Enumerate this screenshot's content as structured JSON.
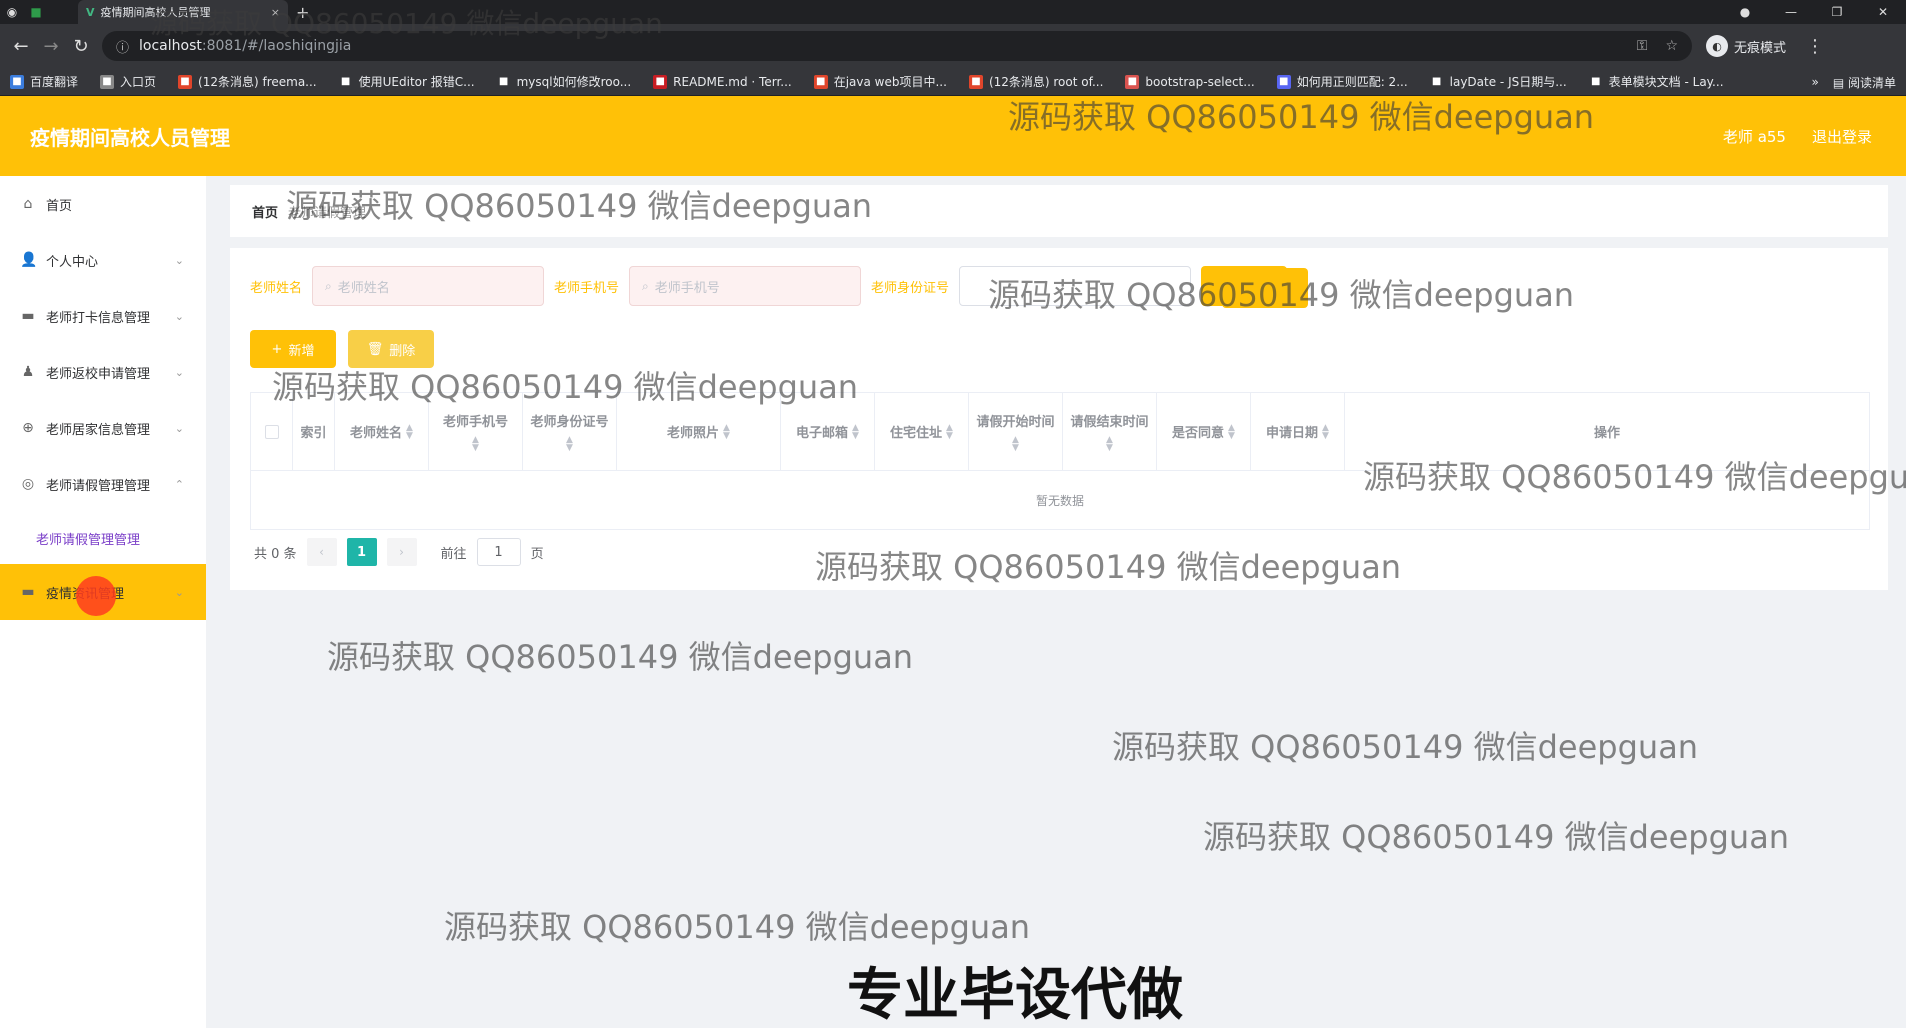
{
  "browser": {
    "tab_title": "疫情期间高校人员管理",
    "tab_close": "×",
    "new_tab": "+",
    "url_host": "localhost",
    "url_path": ":8081/#/laoshiqingjia",
    "incognito_label": "无痕模式",
    "reading_list": "阅读清单",
    "bookmarks": [
      {
        "label": "百度翻译",
        "icon": "translate-icon",
        "color": "#3b7ddd"
      },
      {
        "label": "入口页",
        "icon": "globe-icon",
        "color": "#888888"
      },
      {
        "label": "(12条消息) freema...",
        "icon": "csdn-icon",
        "color": "#e0452b"
      },
      {
        "label": "使用UEditor 报错C...",
        "icon": "doc-icon",
        "color": "#35363a"
      },
      {
        "label": "mysql如何修改roo...",
        "icon": "doc-icon",
        "color": "#35363a"
      },
      {
        "label": "README.md · Terr...",
        "icon": "gitee-icon",
        "color": "#c71d23"
      },
      {
        "label": "在java web项目中...",
        "icon": "csdn-icon",
        "color": "#e0452b"
      },
      {
        "label": "(12条消息) root of...",
        "icon": "csdn-icon",
        "color": "#e0452b"
      },
      {
        "label": "bootstrap-select...",
        "icon": "bookmark-icon",
        "color": "#d9534f"
      },
      {
        "label": "如何用正则匹配: 2...",
        "icon": "bookmark-icon",
        "color": "#5865f2"
      },
      {
        "label": "layDate - JS日期与...",
        "icon": "layui-icon",
        "color": "#35363a"
      },
      {
        "label": "表单模块文档 - Lay...",
        "icon": "layui-icon",
        "color": "#35363a"
      }
    ]
  },
  "header": {
    "title": "疫情期间高校人员管理",
    "user": "老师 a55",
    "logout": "退出登录"
  },
  "sidebar": {
    "items": [
      {
        "label": "首页",
        "icon": "home-icon"
      },
      {
        "label": "个人中心",
        "icon": "user-icon"
      },
      {
        "label": "老师打卡信息管理",
        "icon": "briefcase-icon"
      },
      {
        "label": "老师返校申请管理",
        "icon": "person-icon"
      },
      {
        "label": "老师居家信息管理",
        "icon": "globe-icon"
      },
      {
        "label": "老师请假管理管理",
        "icon": "compass-icon"
      }
    ],
    "sub_item": "老师请假管理管理",
    "active_item": "疫情资讯管理"
  },
  "breadcrumb": {
    "home": "首页",
    "current": "老师请假管理"
  },
  "search": {
    "name_label": "老师姓名",
    "name_placeholder": "老师姓名",
    "phone_label": "老师手机号",
    "phone_placeholder": "老师手机号",
    "id_label": "老师身份证号"
  },
  "actions": {
    "add": "新增",
    "delete": "删除"
  },
  "table": {
    "headers": [
      "索引",
      "老师姓名",
      "老师手机号",
      "老师身份证号",
      "老师照片",
      "电子邮箱",
      "住宅住址",
      "请假开始时间",
      "请假结束时间",
      "是否同意",
      "申请日期",
      "操作"
    ],
    "empty_text": "暂无数据"
  },
  "pagination": {
    "total": "共 0 条",
    "current_page": "1",
    "goto_prefix": "前往",
    "goto_value": "1",
    "goto_suffix": "页",
    "prev": "‹",
    "next": "›"
  },
  "watermark": "源码获取 QQ86050149 微信deepguan",
  "banner": "专业毕设代做",
  "colors": {
    "accent": "#ffc107",
    "page_active": "#1fb5a8",
    "submenu_text": "#7a3ec8"
  }
}
